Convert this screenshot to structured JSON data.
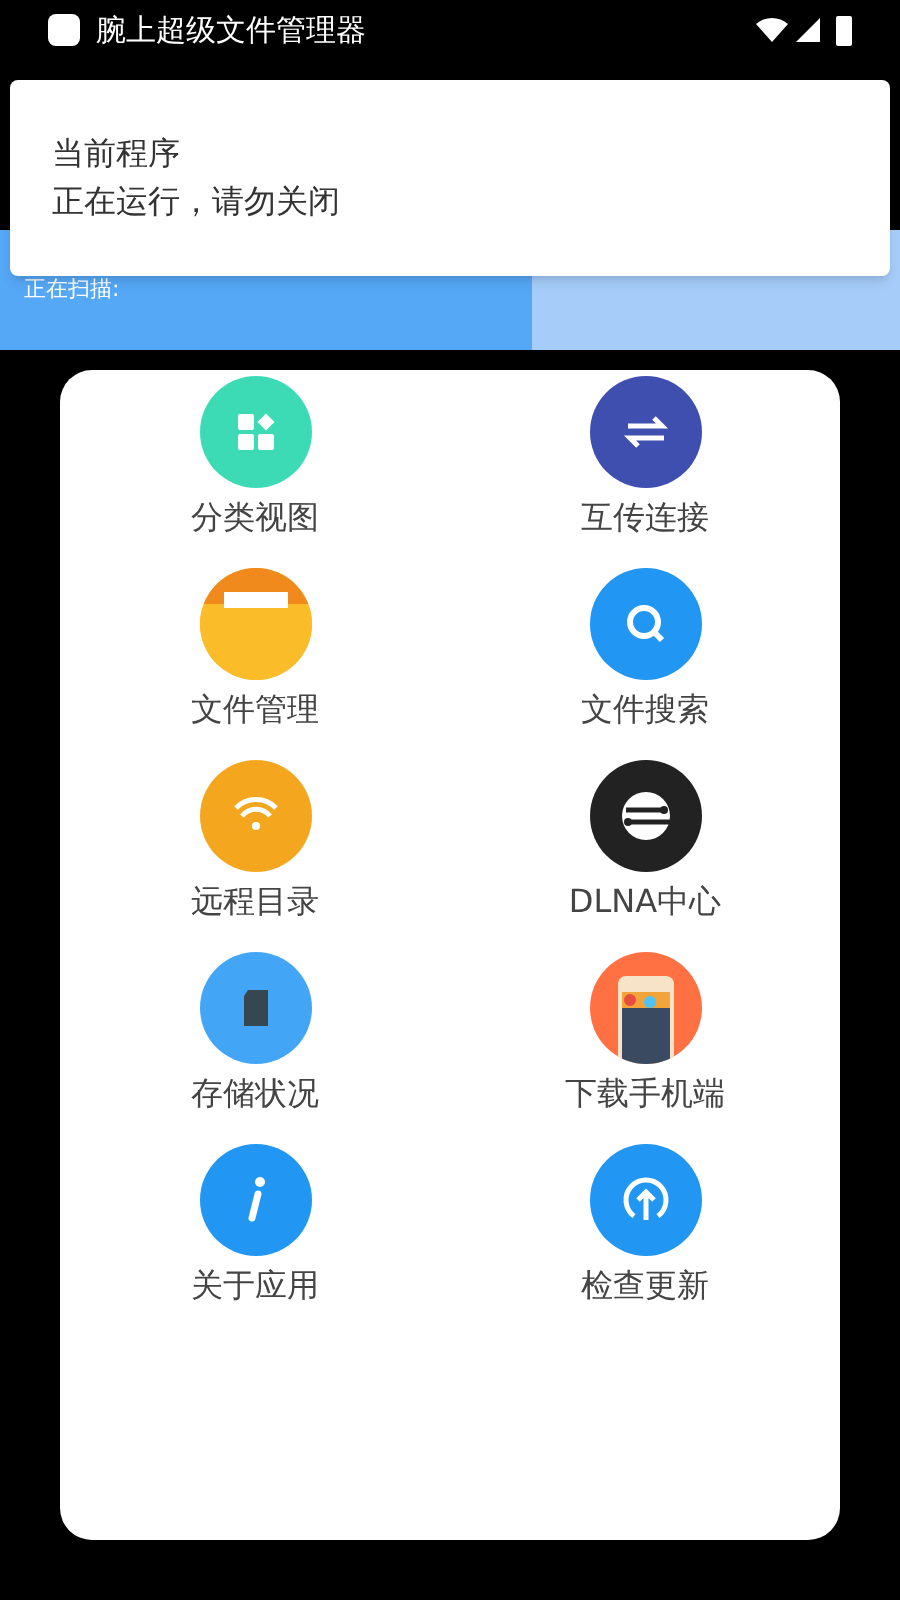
{
  "status_bar": {
    "notification_title": "腕上超级文件管理器"
  },
  "notification": {
    "title": "当前程序",
    "text": "正在运行，请勿关闭"
  },
  "scan": {
    "label": "正在扫描:",
    "level": 0.59
  },
  "menu": [
    {
      "label": "分类视图",
      "kind": "grid"
    },
    {
      "label": "互传连接",
      "kind": "transfer"
    },
    {
      "label": "文件管理",
      "kind": "folder"
    },
    {
      "label": "文件搜索",
      "kind": "search"
    },
    {
      "label": "远程目录",
      "kind": "wifi"
    },
    {
      "label": "DLNA中心",
      "kind": "dlna"
    },
    {
      "label": "存储状况",
      "kind": "sdcard"
    },
    {
      "label": "下载手机端",
      "kind": "phone"
    },
    {
      "label": "关于应用",
      "kind": "info"
    },
    {
      "label": "检查更新",
      "kind": "update"
    }
  ]
}
